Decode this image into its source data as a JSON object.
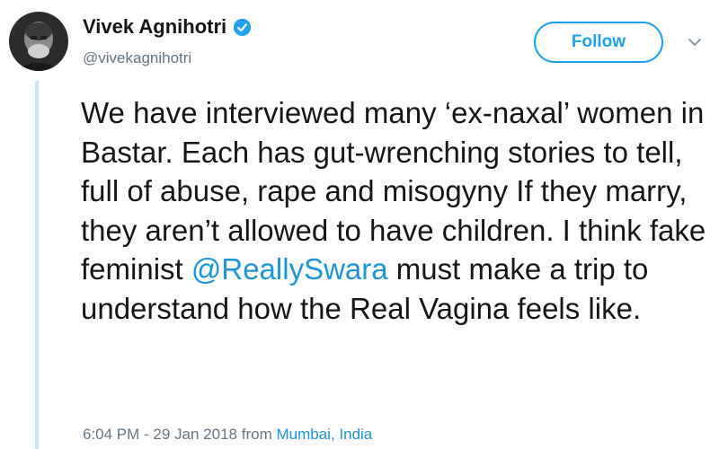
{
  "author": {
    "display_name": "Vivek Agnihotri",
    "handle": "@vivekagnihotri",
    "verified": true
  },
  "follow_button": {
    "label": "Follow"
  },
  "more_menu": {
    "icon": "chevron-down-icon"
  },
  "tweet": {
    "text_before": "We have interviewed many ‘ex-naxal’ women in Bastar. Each has gut-wrenching stories to tell, full of abuse, rape and misogyny If they marry, they aren’t allowed to have children. I think fake feminist ",
    "mention": "@ReallySwara",
    "text_after": " must make a trip to understand how the Real Vagina feels like."
  },
  "meta": {
    "timestamp": "6:04 PM - 29 Jan 2018",
    "from_label": "from",
    "location": "Mumbai, India"
  },
  "colors": {
    "accent": "#1da1f2",
    "link": "#1b95e0",
    "text": "#14171a",
    "muted": "#657786",
    "thread_line": "#c7e6f8"
  }
}
